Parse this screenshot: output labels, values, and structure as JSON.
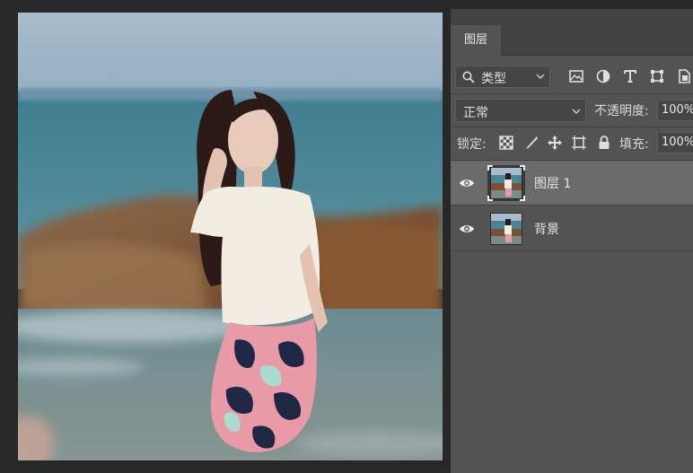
{
  "panel": {
    "tab_label": "图层",
    "filter": {
      "kind_label": "类型"
    },
    "filter_icons": [
      "image-filter-icon",
      "adjustment-filter-icon",
      "type-filter-icon",
      "shape-filter-icon",
      "smart-object-filter-icon"
    ],
    "blend": {
      "mode_label": "正常",
      "opacity_label": "不透明度:",
      "opacity_value": "100%"
    },
    "lock": {
      "label": "锁定:",
      "fill_label": "填充:",
      "fill_value": "100%"
    },
    "lock_icons": [
      "lock-transparent-pixels-icon",
      "lock-image-pixels-icon",
      "lock-position-icon",
      "lock-artboard-icon",
      "lock-all-icon"
    ],
    "layers": [
      {
        "name": "图层 1",
        "visible": true,
        "selected": true
      },
      {
        "name": "背景",
        "visible": true,
        "selected": false
      }
    ]
  },
  "colors": {
    "panel_bg": "#535353",
    "selected_layer_bg": "#6b6b6b",
    "workspace_bg": "#282828"
  }
}
